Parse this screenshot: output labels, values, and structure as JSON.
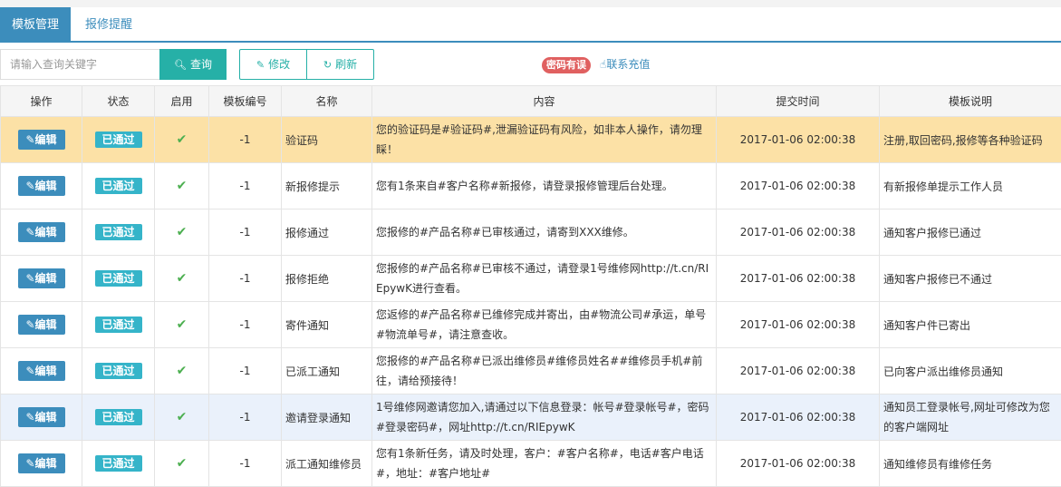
{
  "tabs": [
    {
      "label": "模板管理"
    },
    {
      "label": "报修提醒"
    }
  ],
  "toolbar": {
    "search_placeholder": "请输入查询关键字",
    "query_label": "查询",
    "edit_label": "修改",
    "refresh_label": "刷新",
    "warn_badge": "密码有误",
    "recharge_label": "联系充值"
  },
  "colors": {
    "primary": "#3c8dbc",
    "teal": "#26b0a7",
    "highlight": "#fce1a6",
    "check": "#4caf50"
  },
  "table": {
    "headers": [
      "操作",
      "状态",
      "启用",
      "模板编号",
      "名称",
      "内容",
      "提交时间",
      "模板说明"
    ],
    "edit_label": "编辑",
    "rows": [
      {
        "status": "已通过",
        "enabled": "✔",
        "id": "-1",
        "name": "验证码",
        "content": "您的验证码是#验证码#,泄漏验证码有风险，如非本人操作，请勿理睬！",
        "time": "2017-01-06 02:00:38",
        "desc": "注册,取回密码,报修等各种验证码"
      },
      {
        "status": "已通过",
        "enabled": "✔",
        "id": "-1",
        "name": "新报修提示",
        "content": "您有1条来自#客户名称#新报修，请登录报修管理后台处理。",
        "time": "2017-01-06 02:00:38",
        "desc": "有新报修单提示工作人员"
      },
      {
        "status": "已通过",
        "enabled": "✔",
        "id": "-1",
        "name": "报修通过",
        "content": "您报修的#产品名称#已审核通过，请寄到XXX维修。",
        "time": "2017-01-06 02:00:38",
        "desc": "通知客户报修已通过"
      },
      {
        "status": "已通过",
        "enabled": "✔",
        "id": "-1",
        "name": "报修拒绝",
        "content": "您报修的#产品名称#已审核不通过，请登录1号维修网http://t.cn/RIEpywK进行查看。",
        "time": "2017-01-06 02:00:38",
        "desc": "通知客户报修已不通过"
      },
      {
        "status": "已通过",
        "enabled": "✔",
        "id": "-1",
        "name": "寄件通知",
        "content": "您返修的#产品名称#已维修完成并寄出，由#物流公司#承运，单号#物流单号#，请注意查收。",
        "time": "2017-01-06 02:00:38",
        "desc": "通知客户件已寄出"
      },
      {
        "status": "已通过",
        "enabled": "✔",
        "id": "-1",
        "name": "已派工通知",
        "content": "您报修的#产品名称#已派出维修员#维修员姓名##维修员手机#前往，请给预接待！",
        "time": "2017-01-06 02:00:38",
        "desc": "已向客户派出维修员通知"
      },
      {
        "status": "已通过",
        "enabled": "✔",
        "id": "-1",
        "name": "邀请登录通知",
        "content": "1号维修网邀请您加入,请通过以下信息登录：帐号#登录帐号#，密码#登录密码#，网址http://t.cn/RIEpywK",
        "time": "2017-01-06 02:00:38",
        "desc": "通知员工登录帐号,网址可修改为您的客户端网址"
      },
      {
        "status": "已通过",
        "enabled": "✔",
        "id": "-1",
        "name": "派工通知维修员",
        "content": "您有1条新任务，请及时处理，客户：#客户名称#，电话#客户电话#，地址：#客户地址#",
        "time": "2017-01-06 02:00:38",
        "desc": "通知维修员有维修任务"
      }
    ]
  }
}
